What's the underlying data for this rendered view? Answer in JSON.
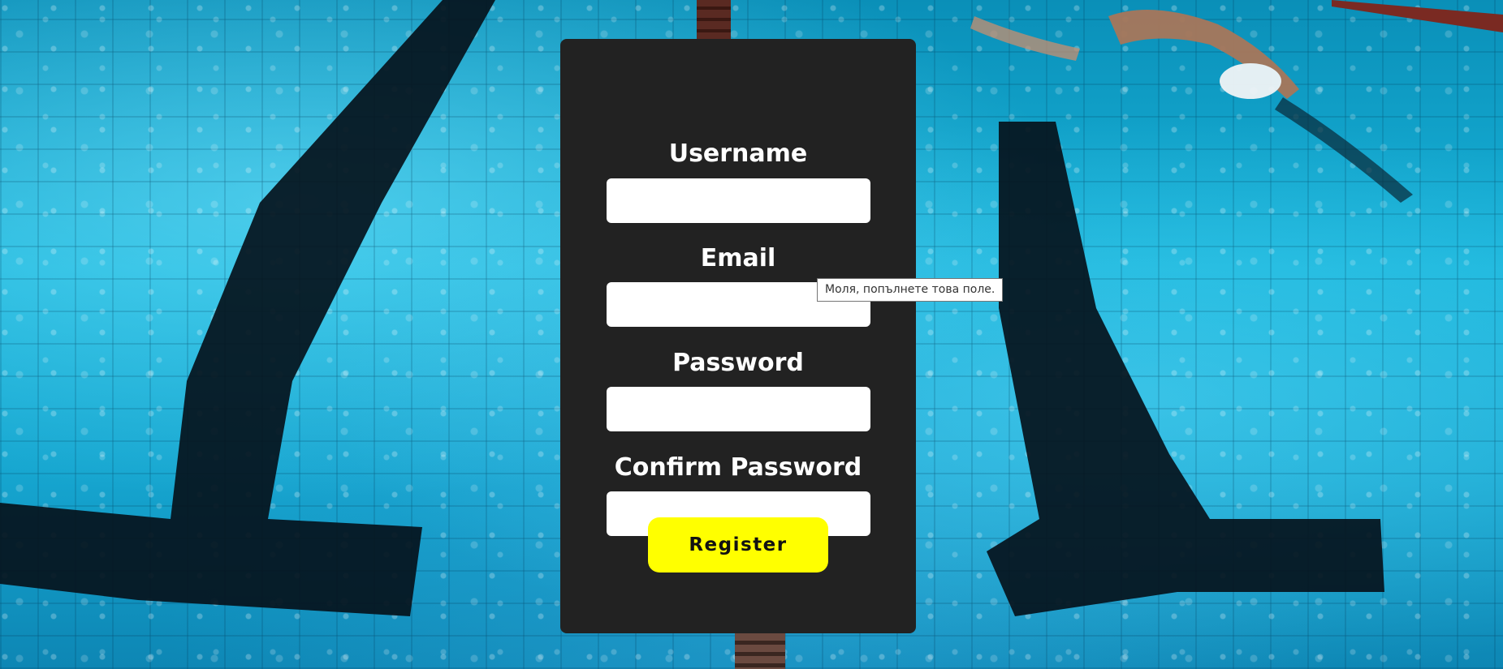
{
  "form": {
    "username_label": "Username",
    "username_value": "",
    "email_label": "Email",
    "email_value": "",
    "password_label": "Password",
    "password_value": "",
    "confirm_password_label": "Confirm Password",
    "confirm_password_value": "",
    "register_label": "Register"
  },
  "validation_tooltip": {
    "text": "Моля, попълнете това поле."
  },
  "colors": {
    "panel_background": "#222222",
    "button_background": "#ffff00",
    "label_text": "#ffffff",
    "pool_water": "#18b4da",
    "lane_lines": "#05121c"
  }
}
